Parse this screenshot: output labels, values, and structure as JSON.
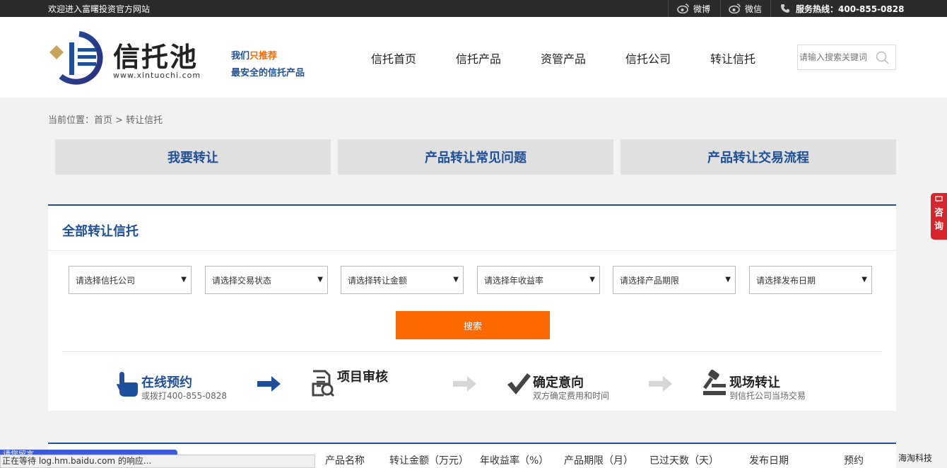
{
  "topbar": {
    "welcome": "欢迎进入富曙投资官方网站",
    "weibo": "微博",
    "weixin": "微信",
    "hotline": "服务热线：400-855-0828"
  },
  "header": {
    "logo_name": "信托池",
    "logo_url": "www.xintuochi.com",
    "slogan_prefix": "我们",
    "slogan_highlight": "只推荐",
    "slogan2": "最安全的信托产品",
    "nav": [
      "信托首页",
      "信托产品",
      "资管产品",
      "信托公司",
      "转让信托"
    ],
    "search_placeholder": "请输入搜索关键词"
  },
  "breadcrumb": "当前位置：首页 > 转让信托",
  "tabs": [
    "我要转让",
    "产品转让常见问题",
    "产品转让交易流程"
  ],
  "filter": {
    "title": "全部转让信托",
    "selects": [
      "请选择信托公司",
      "请选择交易状态",
      "请选择转让金额",
      "请选择年收益率",
      "请选择产品期限",
      "请选择发布日期"
    ],
    "search_label": "搜索"
  },
  "steps": [
    {
      "title": "在线预约",
      "sub": "或拨打400-855-0828"
    },
    {
      "title": "项目审核",
      "sub": ""
    },
    {
      "title": "确定意向",
      "sub": "双方确定费用和时间"
    },
    {
      "title": "现场转让",
      "sub": "到信托公司当场交易"
    }
  ],
  "table_headers": [
    "产品名称",
    "转让金额（万元）",
    "年收益率（%）",
    "产品期限（月）",
    "已过天数（天）",
    "发布日期",
    "预约"
  ],
  "consult": [
    "咨",
    "询"
  ],
  "status": {
    "text": "正在等待 log.hm.baidu.com 的响应...",
    "popup": "请您留言"
  },
  "corner_text": "海淘科技",
  "colors": {
    "brand_blue": "#1e4f9c",
    "orange": "#ff6a00",
    "red": "#d7262b"
  }
}
